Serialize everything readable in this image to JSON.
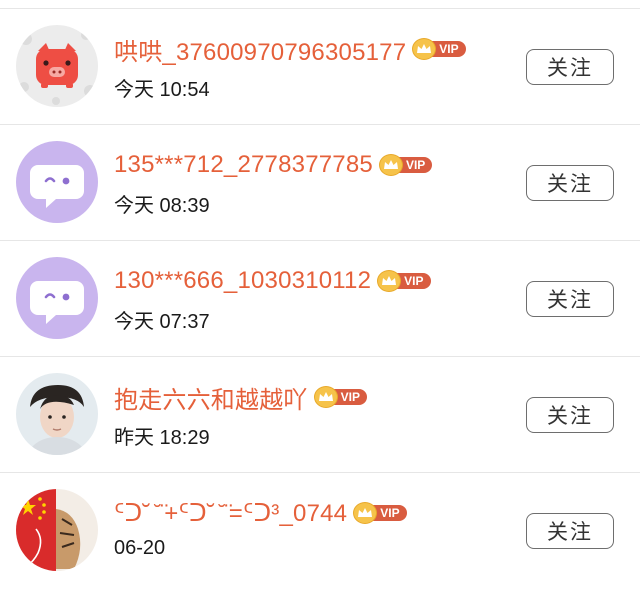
{
  "follow_label": "关注",
  "vip_label": "VIP",
  "users": [
    {
      "name": "哄哄_37600970796305177",
      "time": "今天 10:54",
      "avatar": "pig-avatar"
    },
    {
      "name": "135***712_2778377785",
      "time": "今天 08:39",
      "avatar": "chat-bubble-avatar"
    },
    {
      "name": "130***666_1030310112",
      "time": "今天 07:37",
      "avatar": "chat-bubble-avatar"
    },
    {
      "name": "抱走六六和越越吖",
      "time": "昨天 18:29",
      "avatar": "photo-avatar"
    },
    {
      "name": "ᑦᑐ˘ ̆ ̈+ᑦᑐ˘ ̆ ̈=ᑦᑐ³_0744",
      "time": "06-20",
      "avatar": "flag-avatar"
    }
  ],
  "colors": {
    "name": "#e5603a",
    "vip_tag": "#d95c40",
    "crown": "#f6c34a",
    "chat_avatar_bg": "#c9b5ee",
    "pig_bg": "#e9e9e9",
    "pig_face": "#ee4e44"
  }
}
